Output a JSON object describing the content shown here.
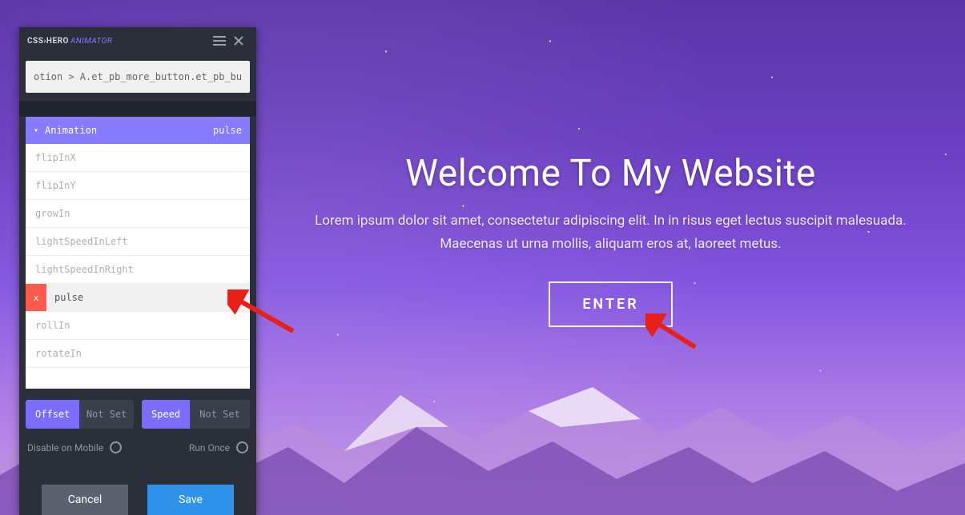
{
  "brand": {
    "strong": "CSS›HERO",
    "accent": "ANIMATOR"
  },
  "selector_value": "otion > A.et_pb_more_button.et_pb_button",
  "animation": {
    "section_label": "Animation",
    "current": "pulse",
    "items": [
      {
        "name": "flipInX",
        "selected": false
      },
      {
        "name": "flipInY",
        "selected": false
      },
      {
        "name": "growIn",
        "selected": false
      },
      {
        "name": "lightSpeedInLeft",
        "selected": false
      },
      {
        "name": "lightSpeedInRight",
        "selected": false
      },
      {
        "name": "pulse",
        "selected": true
      },
      {
        "name": "rollIn",
        "selected": false
      },
      {
        "name": "rotateIn",
        "selected": false
      }
    ]
  },
  "controls": {
    "offset": {
      "label": "Offset",
      "value": "Not Set"
    },
    "speed": {
      "label": "Speed",
      "value": "Not Set"
    }
  },
  "toggles": {
    "mobile_label": "Disable on Mobile",
    "runonce_label": "Run Once"
  },
  "footer": {
    "cancel": "Cancel",
    "save": "Save"
  },
  "hero": {
    "title": "Welcome To My Website",
    "subtitle": "Lorem ipsum dolor sit amet, consectetur adipiscing elit. In in risus eget lectus suscipit malesuada. Maecenas ut urna mollis, aliquam eros at, laoreet metus.",
    "button": "ENTER"
  }
}
